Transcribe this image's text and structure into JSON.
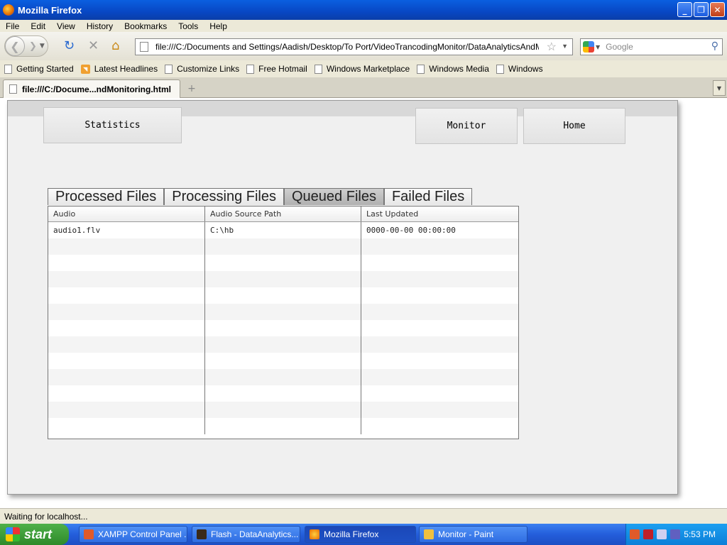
{
  "window": {
    "title": "Mozilla Firefox"
  },
  "menu": [
    "File",
    "Edit",
    "View",
    "History",
    "Bookmarks",
    "Tools",
    "Help"
  ],
  "nav": {
    "url": "file:///C:/Documents and Settings/Aadish/Desktop/To Port/VideoTrancodingMonitor/DataAnalyticsAndMonitoring_M",
    "search_placeholder": "Google"
  },
  "bookmarks": [
    "Getting Started",
    "Latest Headlines",
    "Customize Links",
    "Free Hotmail",
    "Windows Marketplace",
    "Windows Media",
    "Windows"
  ],
  "tab": {
    "label": "file:///C:/Docume...ndMonitoring.html"
  },
  "app": {
    "buttons": {
      "statistics": "Statistics",
      "monitor": "Monitor",
      "home": "Home"
    },
    "file_tabs": [
      "Processed Files",
      "Processing Files",
      "Queued Files",
      "Failed Files"
    ],
    "active_tab": "Queued Files",
    "grid": {
      "columns": [
        "Audio",
        "Audio Source Path",
        "Last Updated"
      ],
      "rows": [
        [
          "audio1.flv",
          "C:\\hb",
          "0000-00-00 00:00:00"
        ]
      ],
      "empty_rows": 12
    }
  },
  "status": "Waiting for localhost...",
  "taskbar": {
    "start": "start",
    "items": [
      "XAMPP Control Panel ...",
      "Flash - DataAnalytics...",
      "Mozilla Firefox",
      "Monitor - Paint"
    ],
    "clock": "5:53 PM"
  }
}
